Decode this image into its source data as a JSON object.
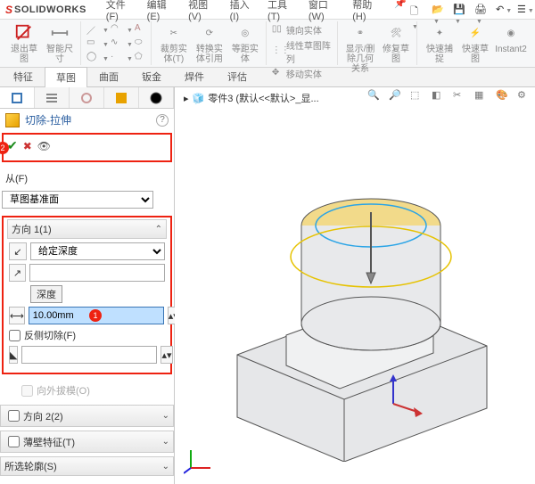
{
  "app": {
    "brand1": "S",
    "brand2": "SOLIDWORKS"
  },
  "menu": [
    "文件(F)",
    "编辑(E)",
    "视图(V)",
    "插入(I)",
    "工具(T)",
    "窗口(W)",
    "帮助(H)"
  ],
  "ribbon": {
    "g1": [
      {
        "label": "退出草图"
      },
      {
        "label": "智能尺寸"
      }
    ],
    "g2": [
      "裁剪实体(T)",
      "转换实体引用",
      "等距实体"
    ],
    "g3": [
      "镜向实体",
      "线性草图阵列",
      "移动实体"
    ],
    "g4": [
      {
        "label": "显示/删除几何关系"
      },
      {
        "label": "修复草图"
      }
    ],
    "g5": [
      {
        "label": "快速捕捉"
      },
      {
        "label": "快速草图"
      },
      {
        "label": "Instant2"
      }
    ]
  },
  "tabs": [
    "特征",
    "草图",
    "曲面",
    "钣金",
    "焊件",
    "评估"
  ],
  "pm": {
    "title": "切除-拉伸",
    "from_label": "从(F)",
    "from_value": "草图基准面",
    "dir1_label": "方向 1(1)",
    "end_cond": "给定深度",
    "depth_label": "深度",
    "depth_value": "10.00mm",
    "flip_label": "反侧切除(F)",
    "draft_label": "向外拔模(O)",
    "dir2_label": "方向 2(2)",
    "thin_label": "薄壁特征(T)",
    "contour_label": "所选轮廓(S)",
    "badge1": "1",
    "badge2": "2"
  },
  "crumb": "零件3 (默认<<默认>_显...",
  "colors": {
    "accent": "#e21"
  }
}
